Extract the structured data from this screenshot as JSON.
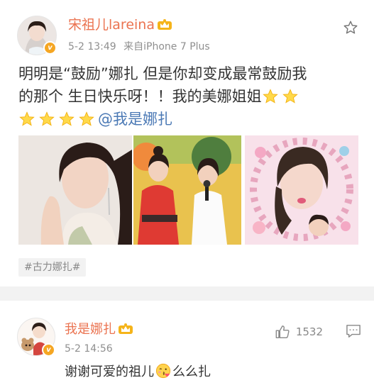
{
  "post": {
    "username": "宋祖儿lareina",
    "time": "5-2 13:49",
    "source": "来自iPhone 7 Plus",
    "text_line1": "明明是“鼓励”娜扎  但是你却变成最常鼓励我",
    "text_line2": "的那个 生日快乐呀！！我的美娜姐姐",
    "mention": "@我是娜扎",
    "hashtag": "#古力娜扎#",
    "star_icon": "star-outline-icon",
    "vip_badge": "v"
  },
  "comment": {
    "username": "我是娜扎",
    "time": "5-2 14:56",
    "text_before": "谢谢可爱的祖儿",
    "text_after": "么么扎",
    "like_count": "1532",
    "vip_badge": "v"
  },
  "colors": {
    "username": "#eb7350",
    "mention": "#4b79b5",
    "meta": "#8f8f8f",
    "badge": "#f5a623"
  }
}
